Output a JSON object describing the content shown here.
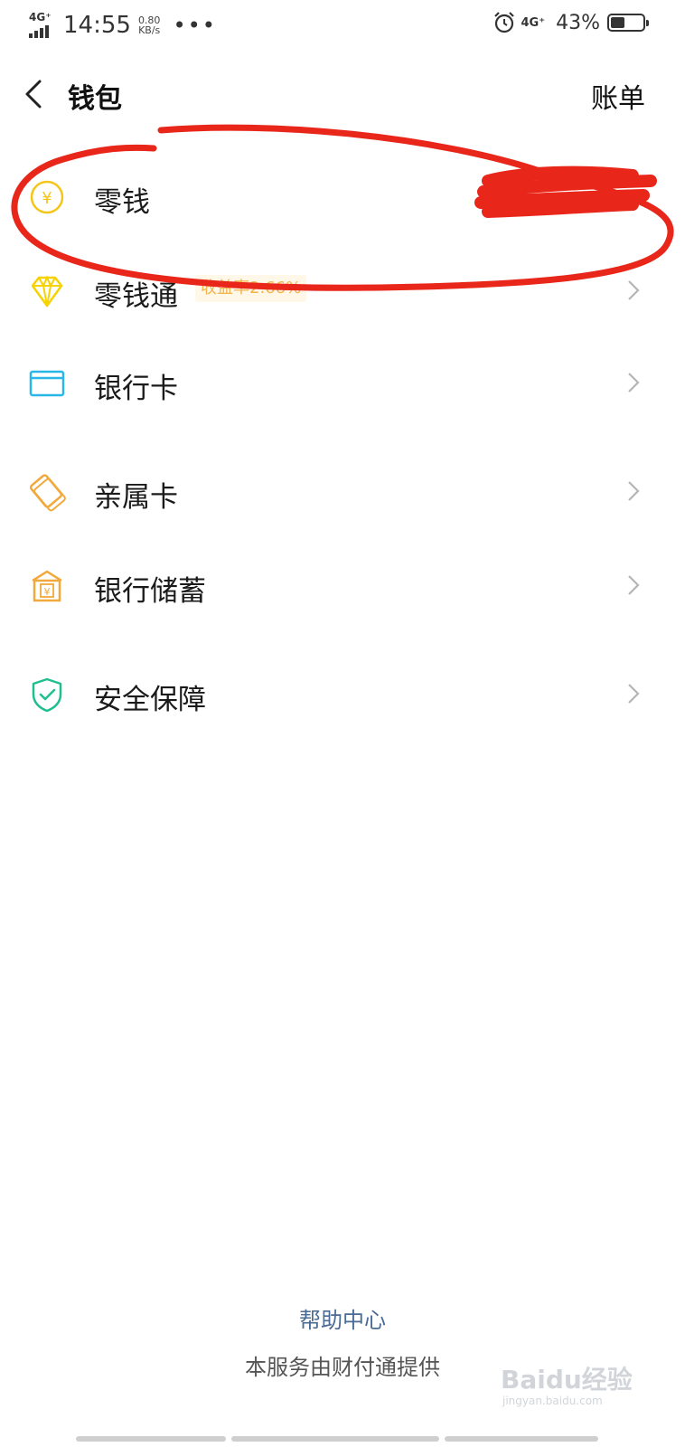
{
  "status_bar": {
    "network": "4G⁺",
    "time": "14:55",
    "speed_value": "0.80",
    "speed_unit": "KB/s",
    "more": "•••",
    "network_right": "4G⁺",
    "battery_percent": "43%",
    "battery_level": 0.43,
    "icons": [
      "signal-icon",
      "alarm-icon",
      "battery-icon"
    ]
  },
  "nav": {
    "title": "钱包",
    "bill_label": "账单",
    "back_icon": "chevron-left-icon"
  },
  "menu": {
    "items": [
      {
        "label": "零钱",
        "icon": "yuan-coin-icon",
        "color": "#f5c518"
      },
      {
        "label": "零钱通",
        "tag": "收益率2.66%",
        "icon": "diamond-icon",
        "color": "#f5d200"
      },
      {
        "label": "银行卡",
        "icon": "card-icon",
        "color": "#29b6e8"
      },
      {
        "label": "亲属卡",
        "icon": "family-card-icon",
        "color": "#f2a93b"
      },
      {
        "label": "银行储蓄",
        "icon": "savings-box-icon",
        "color": "#f2a93b"
      },
      {
        "label": "安全保障",
        "icon": "shield-check-icon",
        "color": "#1fbf8f"
      }
    ]
  },
  "footer": {
    "help": "帮助中心",
    "provider": "本服务由财付通提供"
  },
  "watermark": {
    "logo": "Baidu经验",
    "url": "jingyan.baidu.com"
  },
  "annotation_color": "#e8261a"
}
